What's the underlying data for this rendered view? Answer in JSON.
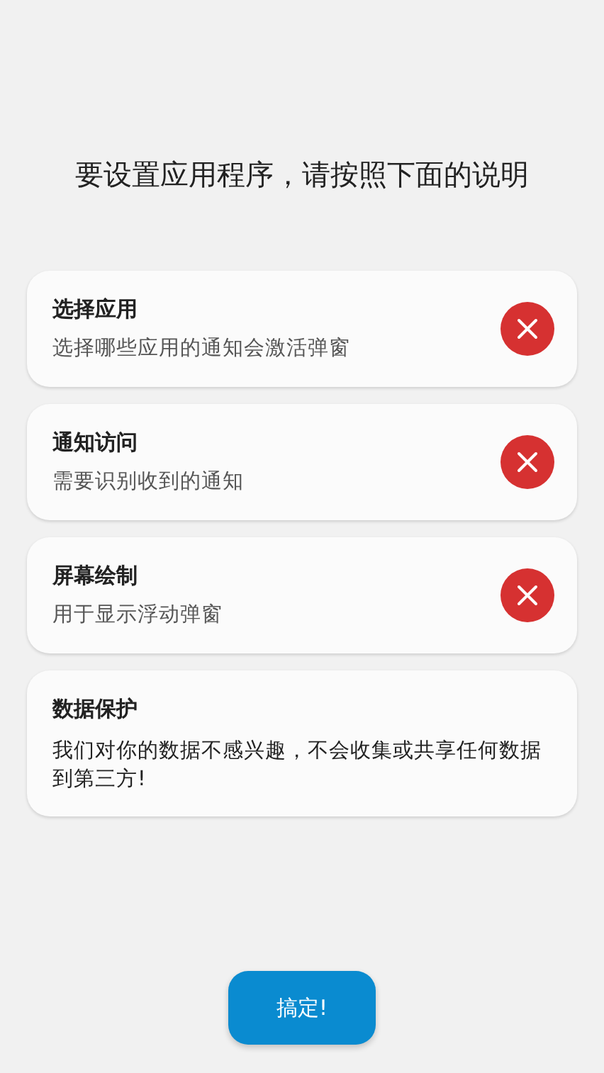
{
  "heading": "要设置应用程序，请按照下面的说明",
  "cards": [
    {
      "kind": "permission",
      "title": "选择应用",
      "description": "选择哪些应用的通知会激活弹窗",
      "granted": false
    },
    {
      "kind": "permission",
      "title": "通知访问",
      "description": "需要识别收到的通知",
      "granted": false
    },
    {
      "kind": "permission",
      "title": "屏幕绘制",
      "description": "用于显示浮动弹窗",
      "granted": false
    },
    {
      "kind": "info",
      "title": "数据保护",
      "description": "我们对你的数据不感兴趣，不会收集或共享任何数据到第三方!"
    }
  ],
  "done_button": "搞定!"
}
